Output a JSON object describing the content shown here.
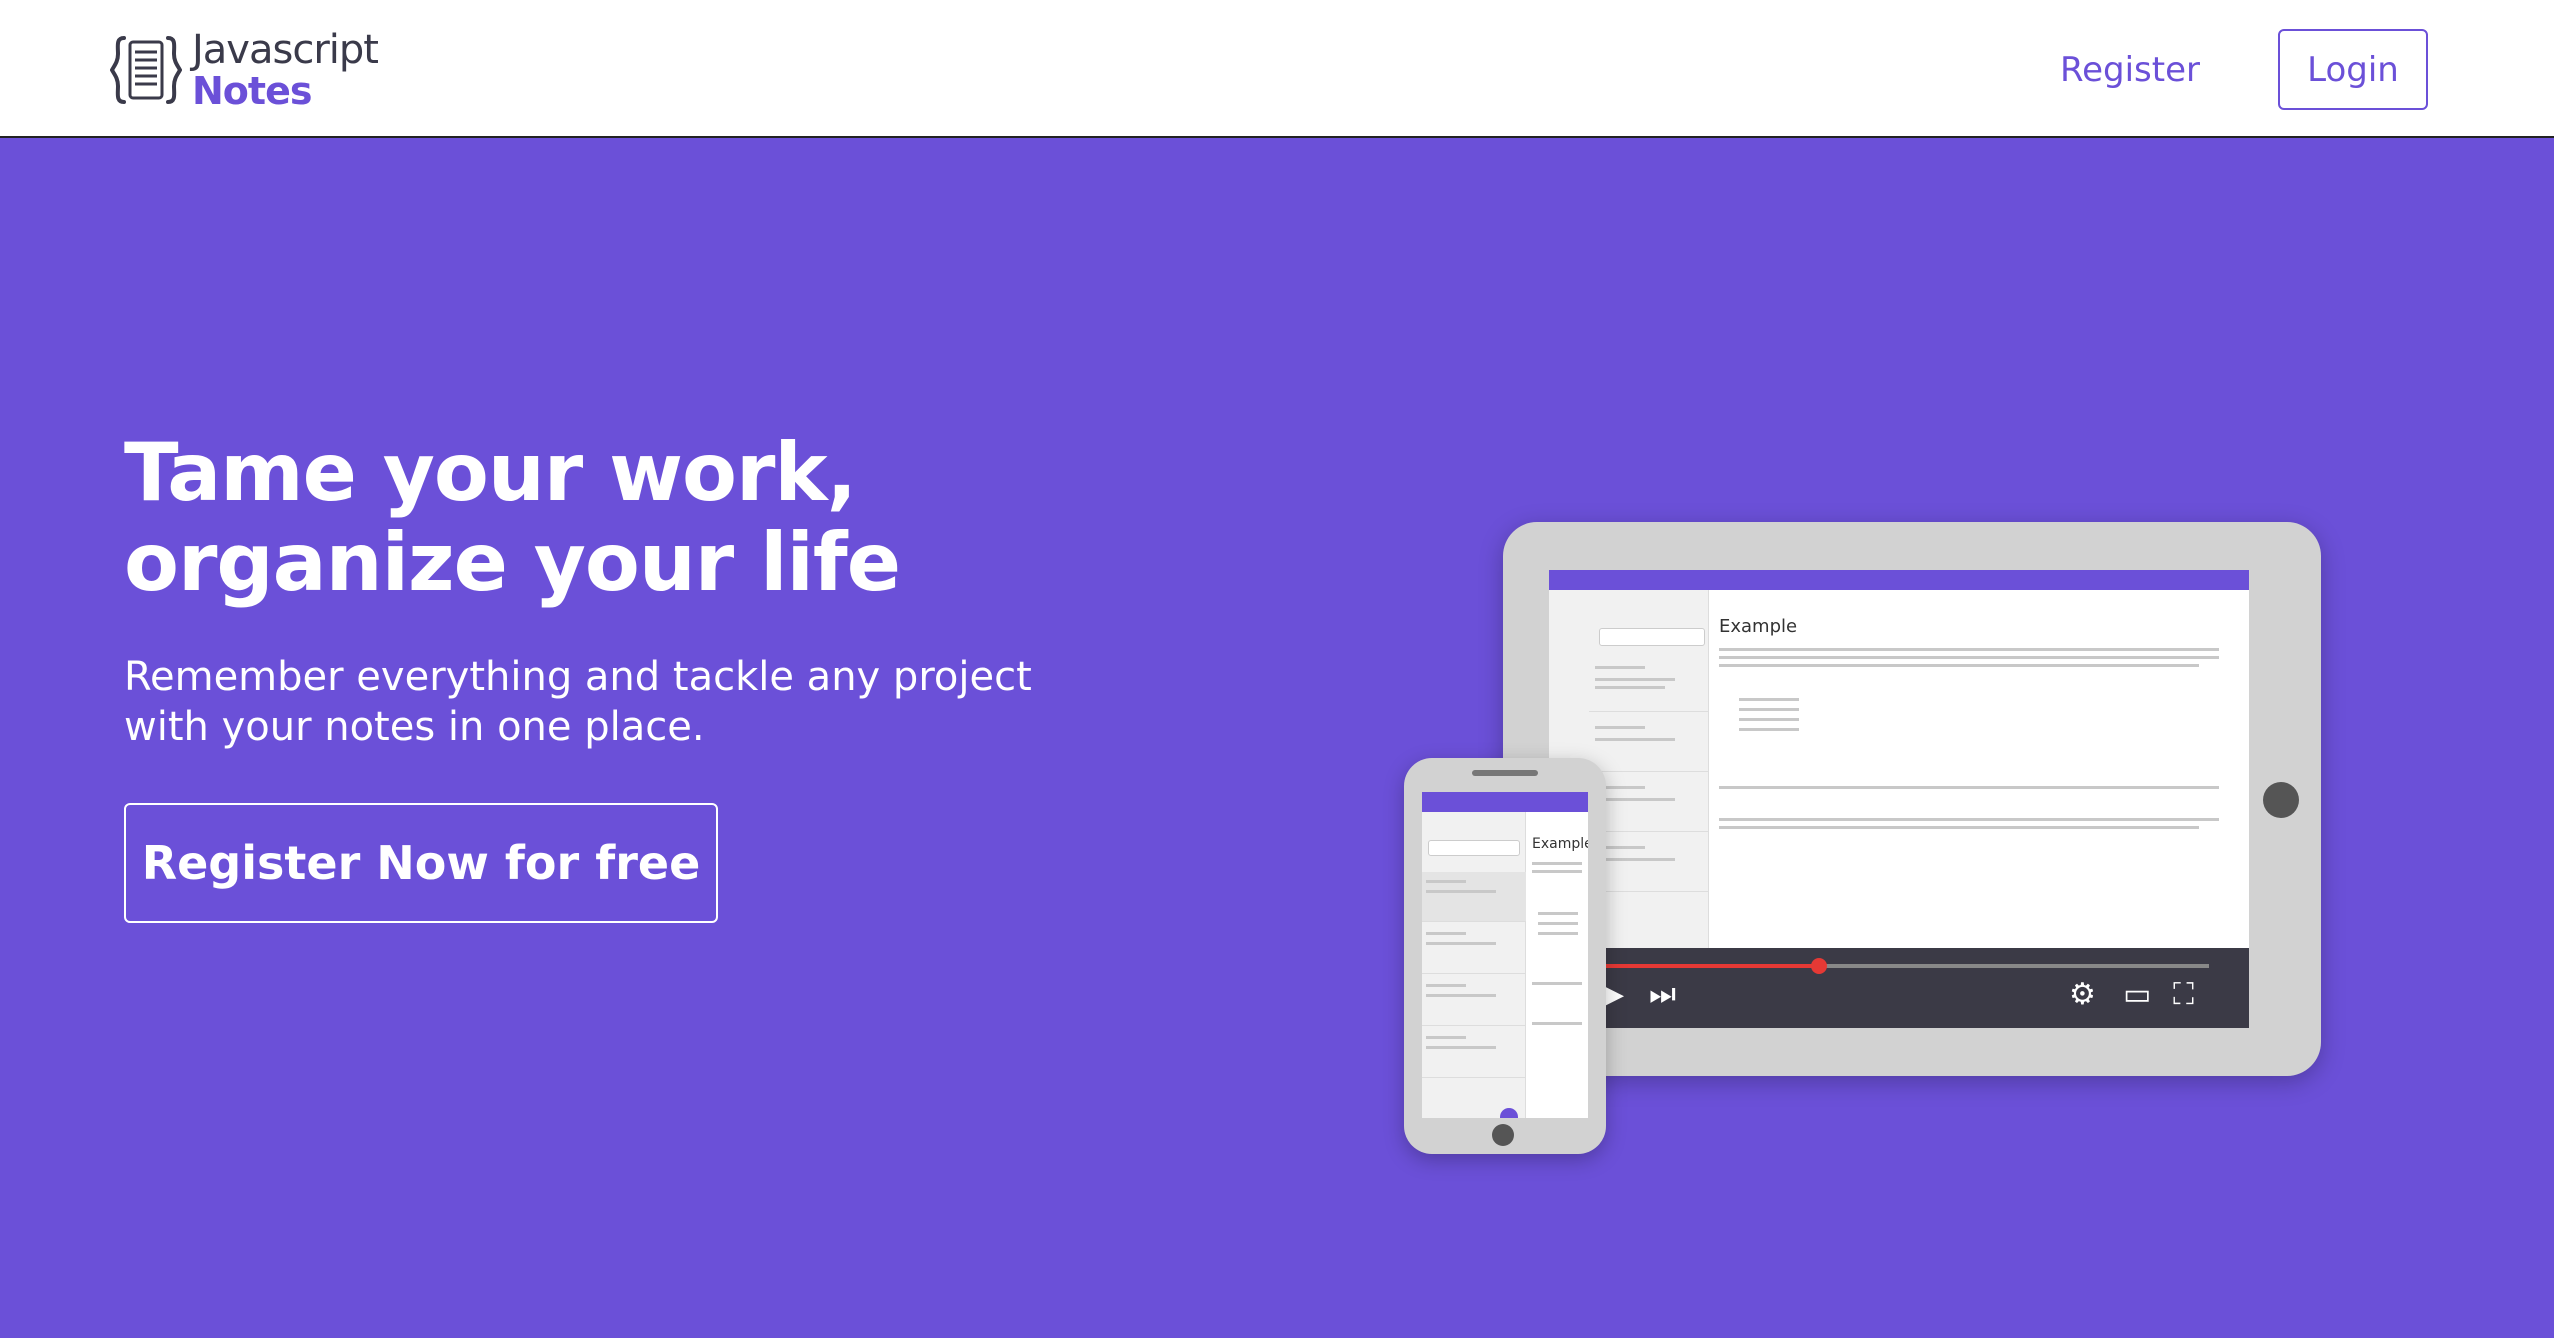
{
  "navbar": {
    "logo_line1": "Javascript",
    "logo_line2": "Notes",
    "register_label": "Register",
    "login_label": "Login"
  },
  "hero": {
    "title_line1": "Tame your work,",
    "title_line2": "organize your life",
    "subtitle": "Remember everything and tackle any project with your notes in one place.",
    "cta_label": "Register Now for free"
  },
  "illustration": {
    "tablet_note_title": "Example",
    "phone_note_title": "Example"
  },
  "colors": {
    "brand_purple": "#6b50d8",
    "navbar_bg": "#ffffff",
    "text_on_brand": "#ffffff"
  }
}
